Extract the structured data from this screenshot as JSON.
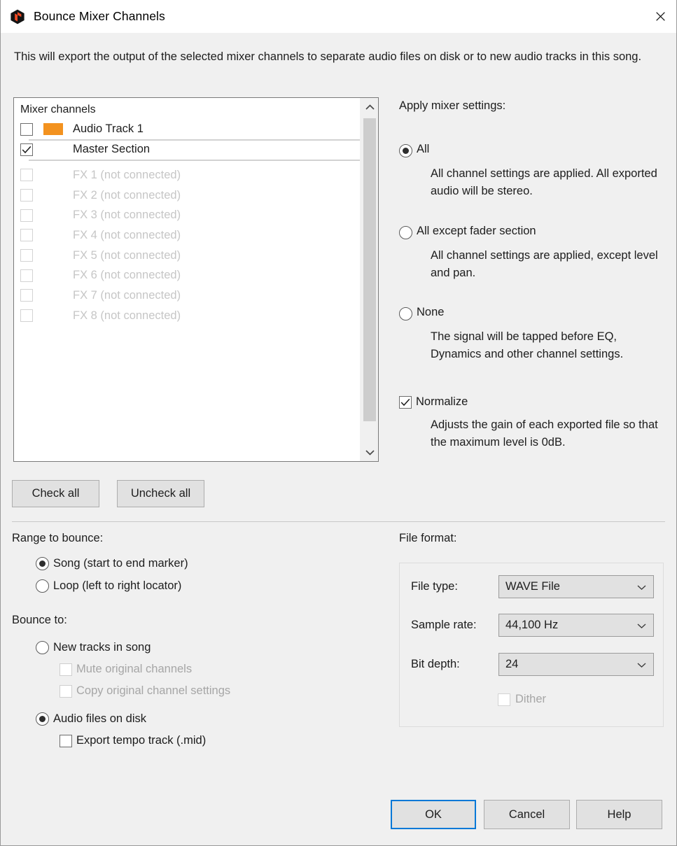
{
  "window": {
    "title": "Bounce Mixer Channels",
    "icon": "app-cube-icon",
    "close_label": "✕"
  },
  "intro": "This will export the output of the selected mixer channels to separate audio files on disk or to new audio tracks in this song.",
  "channel_list": {
    "header": "Mixer channels",
    "items": [
      {
        "label": "Audio Track 1",
        "checked": false,
        "disabled": false,
        "color": "#f3921f",
        "separator_below": true
      },
      {
        "label": "Master Section",
        "checked": true,
        "disabled": false,
        "color": null,
        "separator_below": true
      },
      {
        "label": "FX 1 (not connected)",
        "checked": false,
        "disabled": true,
        "color": null
      },
      {
        "label": "FX 2 (not connected)",
        "checked": false,
        "disabled": true,
        "color": null
      },
      {
        "label": "FX 3 (not connected)",
        "checked": false,
        "disabled": true,
        "color": null
      },
      {
        "label": "FX 4 (not connected)",
        "checked": false,
        "disabled": true,
        "color": null
      },
      {
        "label": "FX 5 (not connected)",
        "checked": false,
        "disabled": true,
        "color": null
      },
      {
        "label": "FX 6 (not connected)",
        "checked": false,
        "disabled": true,
        "color": null
      },
      {
        "label": "FX 7 (not connected)",
        "checked": false,
        "disabled": true,
        "color": null
      },
      {
        "label": "FX 8 (not connected)",
        "checked": false,
        "disabled": true,
        "color": null
      }
    ]
  },
  "list_buttons": {
    "check_all": "Check all",
    "uncheck_all": "Uncheck all"
  },
  "apply_mixer_settings": {
    "title": "Apply mixer settings:",
    "options": [
      {
        "label": "All",
        "selected": true,
        "description": "All channel settings are applied. All exported audio will be stereo."
      },
      {
        "label": "All except fader section",
        "selected": false,
        "description": "All channel settings are applied, except level and pan."
      },
      {
        "label": "None",
        "selected": false,
        "description": "The signal will be tapped before EQ, Dynamics and other channel settings."
      }
    ],
    "normalize": {
      "label": "Normalize",
      "checked": true,
      "description": "Adjusts the gain of each exported file so that the maximum level is 0dB."
    }
  },
  "range_to_bounce": {
    "title": "Range to bounce:",
    "options": [
      {
        "label": "Song (start to end marker)",
        "selected": true
      },
      {
        "label": "Loop (left to right locator)",
        "selected": false
      }
    ]
  },
  "bounce_to": {
    "title": "Bounce to:",
    "options": [
      {
        "label": "New tracks in song",
        "selected": false
      },
      {
        "label": "Audio files on disk",
        "selected": true
      }
    ],
    "new_tracks_sub": [
      {
        "label": "Mute original channels",
        "checked": false,
        "disabled": true
      },
      {
        "label": "Copy original channel settings",
        "checked": false,
        "disabled": true
      }
    ],
    "audio_files_sub": [
      {
        "label": "Export tempo track (.mid)",
        "checked": false,
        "disabled": false
      }
    ]
  },
  "file_format": {
    "title": "File format:",
    "fields": [
      {
        "label": "File type:",
        "value": "WAVE File"
      },
      {
        "label": "Sample rate:",
        "value": "44,100 Hz"
      },
      {
        "label": "Bit depth:",
        "value": "24"
      }
    ],
    "dither": {
      "label": "Dither",
      "checked": false,
      "disabled": true
    }
  },
  "footer": {
    "ok": "OK",
    "cancel": "Cancel",
    "help": "Help"
  },
  "colors": {
    "accent": "#0078d7",
    "track_color": "#f3921f",
    "background": "#f0f0f0",
    "icon_orange": "#f04a23"
  }
}
